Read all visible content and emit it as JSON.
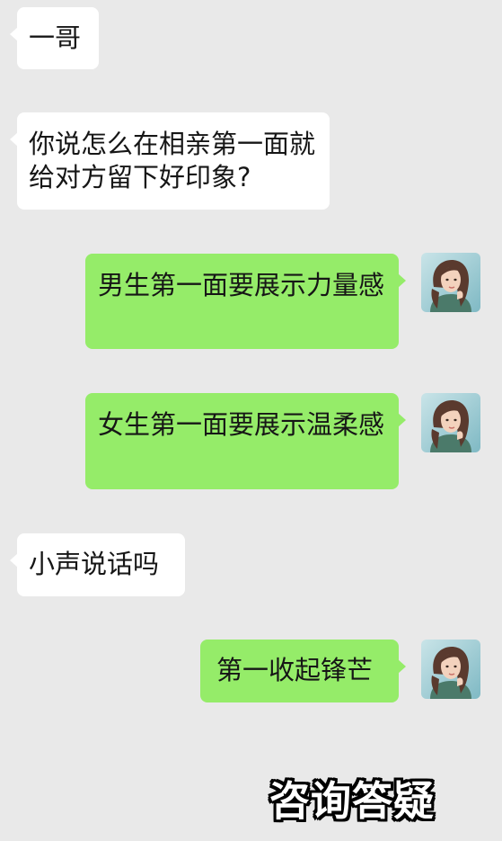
{
  "messages": [
    {
      "side": "incoming",
      "text": "一哥"
    },
    {
      "side": "incoming",
      "text": "你说怎么在相亲第一面就给对方留下好印象?"
    },
    {
      "side": "outgoing",
      "text": "男生第一面要展示力量感"
    },
    {
      "side": "outgoing",
      "text": "女生第一面要展示温柔感"
    },
    {
      "side": "incoming",
      "text": "小声说话吗"
    },
    {
      "side": "outgoing",
      "text": "第一收起锋芒"
    }
  ],
  "avatar": {
    "icon": "woman-portrait-avatar-icon"
  },
  "caption": {
    "text": "咨询答疑"
  },
  "colors": {
    "background": "#e9e9e9",
    "incoming_bubble": "#ffffff",
    "outgoing_bubble": "#95ec69",
    "text": "#161616"
  }
}
